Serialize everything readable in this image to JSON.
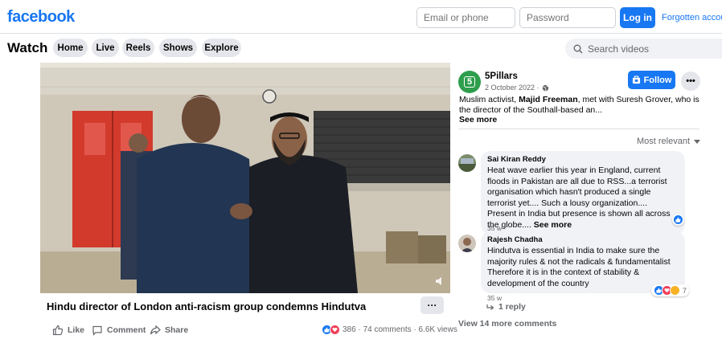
{
  "header": {
    "logo": "facebook",
    "email_placeholder": "Email or phone",
    "password_placeholder": "Password",
    "login_label": "Log in",
    "forgot_label": "Forgotten accou"
  },
  "watchbar": {
    "title": "Watch",
    "tabs": [
      {
        "label": "Home"
      },
      {
        "label": "Live"
      },
      {
        "label": "Reels"
      },
      {
        "label": "Shows"
      },
      {
        "label": "Explore"
      }
    ],
    "search_placeholder": "Search videos"
  },
  "video": {
    "title": "Hindu director of London anti-racism group condemns Hindutva",
    "more_label": "···",
    "actions": {
      "like": "Like",
      "comment": "Comment",
      "share": "Share"
    },
    "stats": "386 · 74 comments · 6.6K views"
  },
  "post": {
    "page_avatar_text": "5",
    "page_name": "5Pillars",
    "date": "2 October 2022 ·",
    "follow_label": "Follow",
    "more_label": "•••",
    "caption_pre": "Muslim activist, ",
    "caption_bold": "Majid Freeman",
    "caption_post": ", met with Suresh Grover, who is the director of the Southall-based an...",
    "see_more": "See more",
    "sort_label": "Most relevant"
  },
  "comments": [
    {
      "name": "Sai Kiran Reddy",
      "text": "Heat wave earlier this year in England, current floods in Pakistan are all due to RSS...a terrorist organisation which hasn't produced a single terrorist yet.... Such a lousy organization.... Present in India but presence is shown all across the globe....",
      "see_more": "See more",
      "time": "35 w"
    },
    {
      "name": "Rajesh Chadha",
      "text": "Hindutva is essential in India to make sure the majority rules & not the radicals & fundamentalist Therefore it is in the context of stability & development of the country",
      "time": "35 w",
      "reaction_count": "7"
    }
  ],
  "reply_label": "1 reply",
  "view_more_label": "View 14 more comments",
  "colors": {
    "brand": "#1877f2",
    "secondary_text": "#65676b",
    "pill_bg": "#e4e6eb",
    "bubble_bg": "#f0f2f5"
  }
}
